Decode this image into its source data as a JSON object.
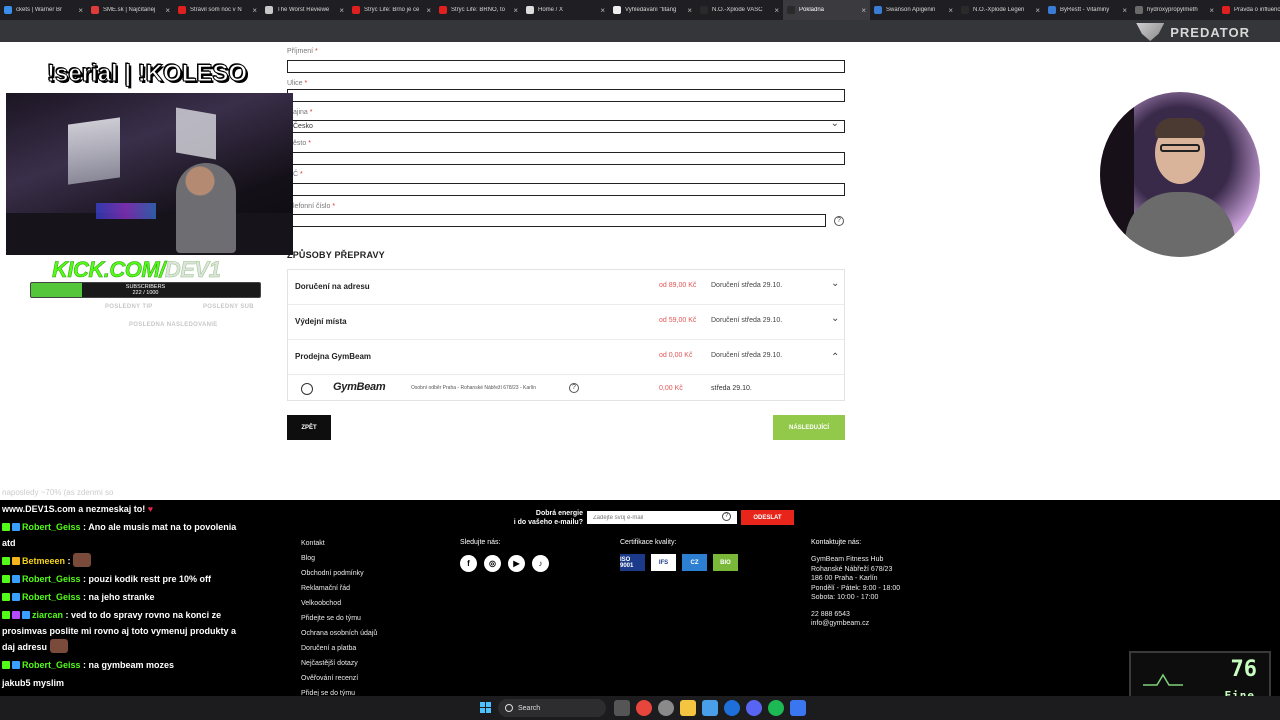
{
  "browser": {
    "tabs": [
      {
        "title": "ckets | Warner Br",
        "color": "#3b8eea"
      },
      {
        "title": "SME.sk | Najčítanej",
        "color": "#e03b3b"
      },
      {
        "title": "Strávil som noc v N",
        "color": "#e02020"
      },
      {
        "title": "The Worst Reviewe",
        "color": "#c8c8c8"
      },
      {
        "title": "Strýc Life: Brno je ce",
        "color": "#e02020"
      },
      {
        "title": "Strýc Life: BRNO, to",
        "color": "#e02020"
      },
      {
        "title": "Home / X",
        "color": "#dddddd"
      },
      {
        "title": "Vyhledávání \"titang",
        "color": "#eeeeee"
      },
      {
        "title": "N.O.-Xplode VASC",
        "color": "#2a2a2a"
      },
      {
        "title": "Pokladna",
        "color": "#2a2a2a"
      },
      {
        "title": "Swanson Apigenin",
        "color": "#3a7bd5"
      },
      {
        "title": "N.O.-Xplode Legen",
        "color": "#2a2a2a"
      },
      {
        "title": "ByRestt - Vitaminy ",
        "color": "#3a7bd5"
      },
      {
        "title": "hydroxypropylmeth",
        "color": "#6a6a6a"
      },
      {
        "title": "Pravda o influence",
        "color": "#e02020"
      }
    ],
    "active_tab": "Pokladna",
    "brand": "PREDATOR"
  },
  "form": {
    "fields": [
      {
        "label": "Příjmení",
        "value": ""
      },
      {
        "label": "Ulice",
        "value": ""
      },
      {
        "label": "Země",
        "label_visible": "ajina",
        "value": "Česko"
      },
      {
        "label": "Město",
        "label_visible": "ěsto",
        "value": ""
      },
      {
        "label": "PSČ",
        "label_visible": "Č",
        "value": ""
      },
      {
        "label": "Telefonní číslo",
        "label_visible": "lefonní číslo",
        "value": ""
      }
    ]
  },
  "shipping": {
    "title": "ZPŮSOBY PŘEPRAVY",
    "methods": [
      {
        "name": "Doručení na adresu",
        "price": "od 89,00 Kč",
        "delivery": "Doručení středa 29.10.",
        "expanded": false
      },
      {
        "name": "Výdejní místa",
        "price": "od 59,00 Kč",
        "delivery": "Doručení středa 29.10.",
        "expanded": false
      },
      {
        "name": "Prodejna GymBeam",
        "price": "od 0,00 Kč",
        "delivery": "Doručení středa 29.10.",
        "expanded": true
      }
    ],
    "option": {
      "logo": "GymBeam",
      "address": "Osobní odběr Praha - Rohanské Nábřeží 678/23 - Karlín",
      "price": "0,00 Kč",
      "date": "středa 29.10."
    },
    "back_label": "ZPĚT",
    "next_label": "NÁSLEDUJÍCÍ"
  },
  "overlay": {
    "title": "!serial | !KOLESO",
    "kick": "KICK.COM/",
    "kick_user": "DEV1",
    "subscribers_label": "SUBSCRIBERS",
    "subscribers_count": "222 / 1000",
    "subscribers_current": 222,
    "subscribers_goal": 1000,
    "faded_line_1": "POSLEDNÝ TIP",
    "faded_line_2": "POSLEDNÝ SUB",
    "faded_line_3": "POSLEDNÁ NÁSLEDOVANIE"
  },
  "chat": {
    "faded": "naposledy ~70% (as zdenmi so",
    "banner": "www.DEV1S.com a nezmeskaj to!",
    "messages": [
      {
        "user": "Robert_Geiss",
        "text": "Ano ale musis mat na to povolenia atd",
        "badges": [
          "kick",
          "sub"
        ]
      },
      {
        "user": "Betmeeen",
        "text": "",
        "badges": [
          "kick",
          "gift"
        ],
        "emote": true
      },
      {
        "user": "Robert_Geiss",
        "text": "pouzi kodik restt pre 10% off",
        "badges": [
          "kick",
          "sub"
        ]
      },
      {
        "user": "Robert_Geiss",
        "text": "na jeho stranke",
        "badges": [
          "kick",
          "sub"
        ]
      },
      {
        "user": "ziarcan",
        "text": "ved to do spravy rovno na konci ze prosimvas poslite mi rovno aj toto vymenuj produkty a daj adresu",
        "badges": [
          "kick",
          "heart",
          "sub"
        ],
        "emote": true
      },
      {
        "user": "Robert_Geiss",
        "text": "na gymbeam mozes",
        "badges": [
          "kick",
          "sub"
        ]
      }
    ],
    "trailing": "jakub5 myslim"
  },
  "footer": {
    "newsletter_label_1": "Dobrá energie",
    "newsletter_label_2": "i do vašeho e-mailu?",
    "newsletter_placeholder": "Zadejte svůj e-mail",
    "newsletter_button": "ODESLAT",
    "links": [
      "Kontakt",
      "Blog",
      "Obchodní podmínky",
      "Reklamační řád",
      "Velkoobchod",
      "Přidejte se do týmu",
      "Ochrana osobních údajů",
      "Doručení a platba",
      "Nejčastější dotazy",
      "Ověřování recenzí",
      "Přidej se do týmu"
    ],
    "follow_title": "Sledujte nás:",
    "social": [
      "facebook",
      "instagram",
      "youtube",
      "tiktok"
    ],
    "cert_title": "Certifikace kvality:",
    "certs": [
      {
        "label": "ISO 9001",
        "color": "#1b3a8a"
      },
      {
        "label": "IFS",
        "color": "#ffffff"
      },
      {
        "label": "CZ",
        "color": "#2c7fd1"
      },
      {
        "label": "BIO",
        "color": "#7ab83a"
      }
    ],
    "contact_title": "Kontaktujte nás:",
    "contact_lines": [
      "GymBeam Fitness Hub",
      "Rohanské Nábřeží 678/23",
      "186 00 Praha - Karlín",
      "Pondělí - Pátek: 9:00 - 18:00",
      "Sobota: 10:00 - 17:00",
      "",
      "22 888 6543",
      "info@gymbeam.cz"
    ]
  },
  "widget": {
    "value": "76",
    "status": "Fine"
  },
  "taskbar": {
    "search_label": "Search"
  }
}
